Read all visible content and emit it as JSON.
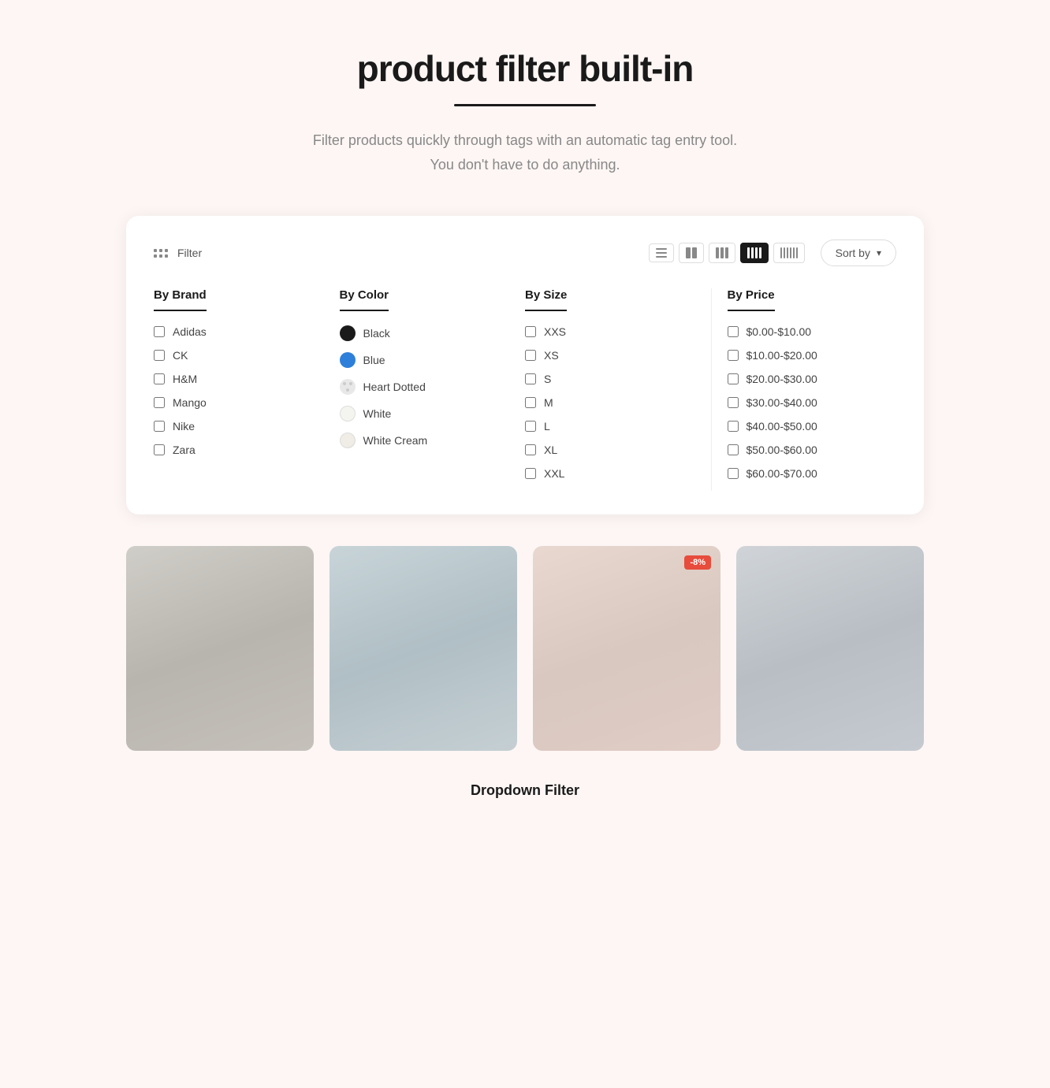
{
  "header": {
    "title": "product filter built-in",
    "subtitle_line1": "Filter products quickly through tags with an automatic tag entry tool.",
    "subtitle_line2": "You don't have to do anything."
  },
  "toolbar": {
    "filter_label": "Filter",
    "sort_label": "Sort by",
    "view_modes": [
      {
        "id": "list",
        "label": "List view"
      },
      {
        "id": "2col",
        "label": "2 columns"
      },
      {
        "id": "3col",
        "label": "3 columns"
      },
      {
        "id": "4col",
        "label": "4 columns",
        "active": true
      },
      {
        "id": "6col",
        "label": "6 columns"
      }
    ]
  },
  "filters": {
    "brand": {
      "title": "By Brand",
      "items": [
        {
          "label": "Adidas"
        },
        {
          "label": "CK"
        },
        {
          "label": "H&M"
        },
        {
          "label": "Mango"
        },
        {
          "label": "Nike"
        },
        {
          "label": "Zara"
        }
      ]
    },
    "color": {
      "title": "By Color",
      "items": [
        {
          "label": "Black",
          "swatch": "black"
        },
        {
          "label": "Blue",
          "swatch": "blue"
        },
        {
          "label": "Heart Dotted",
          "swatch": "heart-dotted"
        },
        {
          "label": "White",
          "swatch": "white"
        },
        {
          "label": "White Cream",
          "swatch": "white-cream"
        }
      ]
    },
    "size": {
      "title": "By Size",
      "items": [
        {
          "label": "XXS"
        },
        {
          "label": "XS"
        },
        {
          "label": "S"
        },
        {
          "label": "M"
        },
        {
          "label": "L"
        },
        {
          "label": "XL"
        },
        {
          "label": "XXL"
        }
      ]
    },
    "price": {
      "title": "By Price",
      "items": [
        {
          "label": "$0.00-$10.00"
        },
        {
          "label": "$10.00-$20.00"
        },
        {
          "label": "$20.00-$30.00"
        },
        {
          "label": "$30.00-$40.00"
        },
        {
          "label": "$40.00-$50.00"
        },
        {
          "label": "$50.00-$60.00"
        },
        {
          "label": "$60.00-$70.00"
        }
      ]
    }
  },
  "products": [
    {
      "id": 1,
      "img_class": "product-img-1",
      "badge": null
    },
    {
      "id": 2,
      "img_class": "product-img-2",
      "badge": null
    },
    {
      "id": 3,
      "img_class": "product-img-3",
      "badge": "-8%"
    },
    {
      "id": 4,
      "img_class": "product-img-4",
      "badge": null
    }
  ],
  "section_label": "Dropdown Filter"
}
